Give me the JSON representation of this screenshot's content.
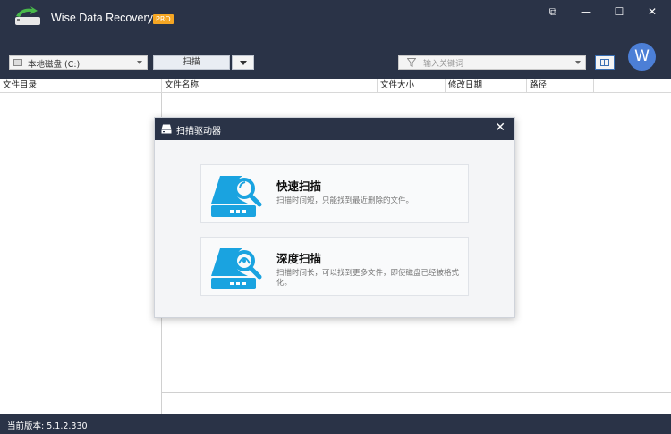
{
  "app": {
    "title": "Wise Data Recovery",
    "badge": "PRO"
  },
  "window_controls": {
    "restore": "⧉",
    "minimize": "—",
    "maximize": "☐",
    "close": "✕"
  },
  "toolbar": {
    "drive_select": "本地磁盘 (C:)",
    "scan_label": "扫描",
    "search_placeholder": "输入关键词",
    "avatar_letter": "W"
  },
  "columns": {
    "directory": "文件目录",
    "name": "文件名称",
    "size": "文件大小",
    "modified": "修改日期",
    "path": "路径"
  },
  "dialog": {
    "title": "扫描驱动器",
    "close": "✕",
    "options": [
      {
        "title": "快速扫描",
        "description": "扫描时间短，只能找到最近删除的文件。"
      },
      {
        "title": "深度扫描",
        "description": "扫描时间长，可以找到更多文件，即使磁盘已经被格式化。"
      }
    ]
  },
  "status": {
    "version": "当前版本: 5.1.2.330"
  },
  "colors": {
    "dark_bg": "#2a3347",
    "accent_blue": "#1aa3e0",
    "badge": "#f5a623"
  }
}
